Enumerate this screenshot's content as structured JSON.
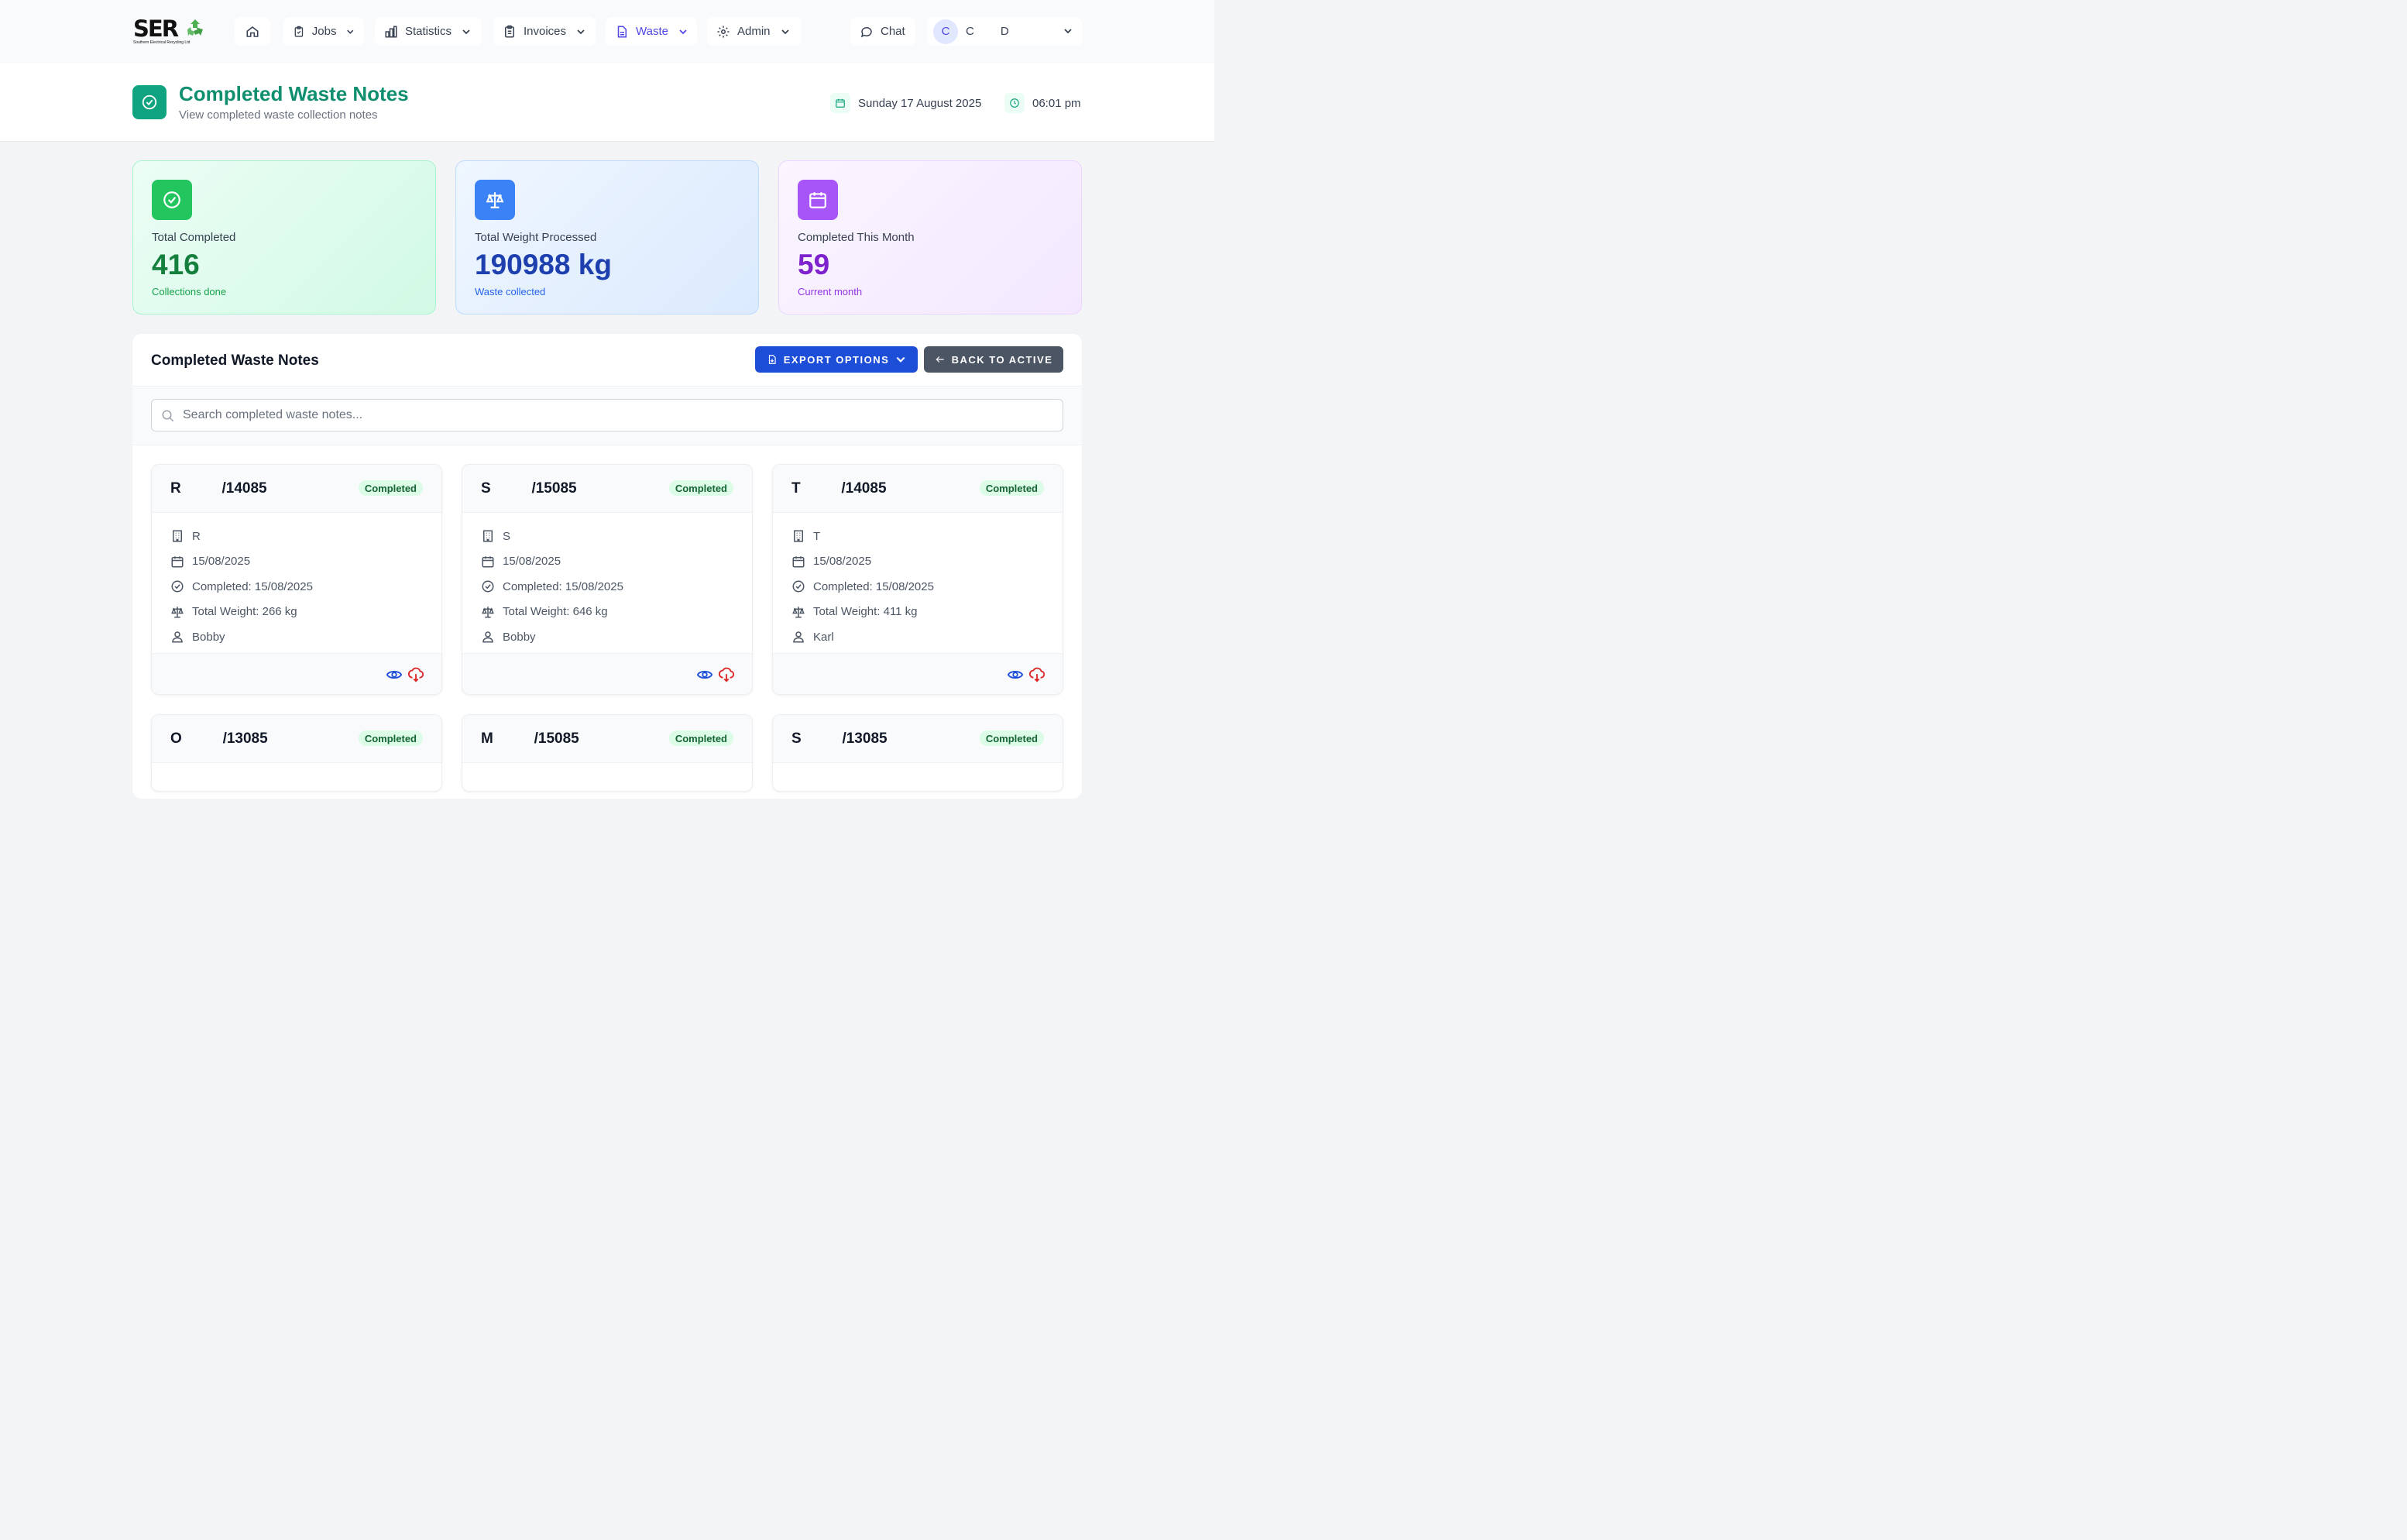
{
  "brand": {
    "logo_text": "SER",
    "logo_sub": "Southern Electrical Recycling Ltd"
  },
  "nav": {
    "jobs": "Jobs",
    "statistics": "Statistics",
    "invoices": "Invoices",
    "waste": "Waste",
    "admin": "Admin",
    "chat": "Chat",
    "user_initial": "C",
    "user_first": "C",
    "user_last": "D"
  },
  "header": {
    "title": "Completed Waste Notes",
    "subtitle": "View completed waste collection notes",
    "date": "Sunday 17 August 2025",
    "time": "06:01 pm"
  },
  "stats": {
    "total": {
      "label": "Total Completed",
      "value": "416",
      "caption": "Collections done"
    },
    "weight": {
      "label": "Total Weight Processed",
      "value": "190988 kg",
      "caption": "Waste collected"
    },
    "month": {
      "label": "Completed This Month",
      "value": "59",
      "caption": "Current month"
    }
  },
  "panel": {
    "title": "Completed Waste Notes",
    "export_label": "EXPORT OPTIONS",
    "back_label": "BACK TO ACTIVE",
    "search_placeholder": "Search completed waste notes..."
  },
  "cards": [
    {
      "title": "R          /14085",
      "status": "Completed",
      "company": "R",
      "date": "15/08/2025",
      "completed": "Completed: 15/08/2025",
      "weight": "Total Weight: 266 kg",
      "driver": "Bobby"
    },
    {
      "title": "S          /15085",
      "status": "Completed",
      "company": "S",
      "date": "15/08/2025",
      "completed": "Completed: 15/08/2025",
      "weight": "Total Weight: 646 kg",
      "driver": "Bobby"
    },
    {
      "title": "T          /14085",
      "status": "Completed",
      "company": "T",
      "date": "15/08/2025",
      "completed": "Completed: 15/08/2025",
      "weight": "Total Weight: 411 kg",
      "driver": "Karl"
    },
    {
      "title": "O          /13085",
      "status": "Completed"
    },
    {
      "title": "M          /15085",
      "status": "Completed"
    },
    {
      "title": "S          /13085",
      "status": "Completed"
    }
  ],
  "colors": {
    "accent": "#0f8f6f",
    "nav_active": "#4f46e5",
    "export": "#1d4ed8",
    "back": "#4b5563"
  }
}
